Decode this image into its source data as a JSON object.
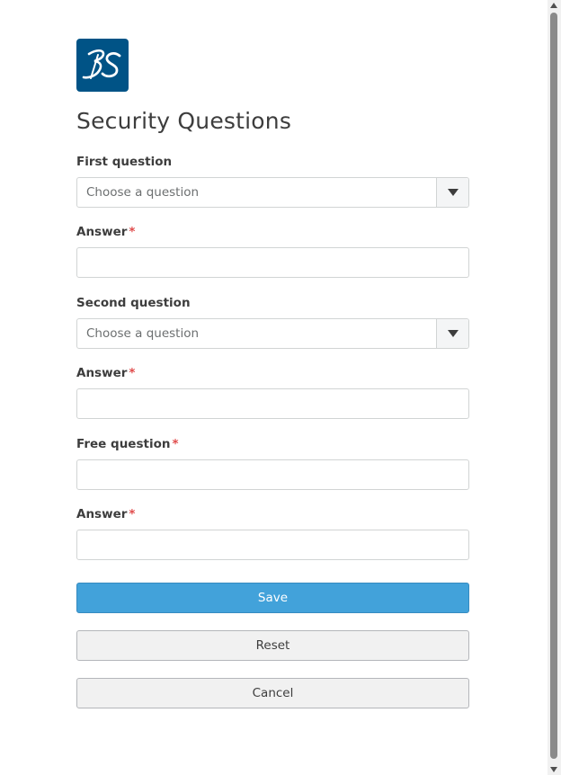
{
  "form": {
    "title": "Security Questions",
    "first_question": {
      "label": "First question",
      "selected": "Choose a question"
    },
    "first_answer": {
      "label": "Answer",
      "required_mark": "*",
      "value": ""
    },
    "second_question": {
      "label": "Second question",
      "selected": "Choose a question"
    },
    "second_answer": {
      "label": "Answer",
      "required_mark": "*",
      "value": ""
    },
    "free_question": {
      "label": "Free question",
      "required_mark": "*",
      "value": ""
    },
    "free_answer": {
      "label": "Answer",
      "required_mark": "*",
      "value": ""
    }
  },
  "actions": {
    "save_label": "Save",
    "reset_label": "Reset",
    "cancel_label": "Cancel"
  },
  "colors": {
    "logo_background": "#005386",
    "primary_button": "#42a2da",
    "required_mark": "#e04b4b"
  },
  "icons": {
    "logo": "3ds-logo",
    "dropdown": "chevron-down-icon"
  }
}
